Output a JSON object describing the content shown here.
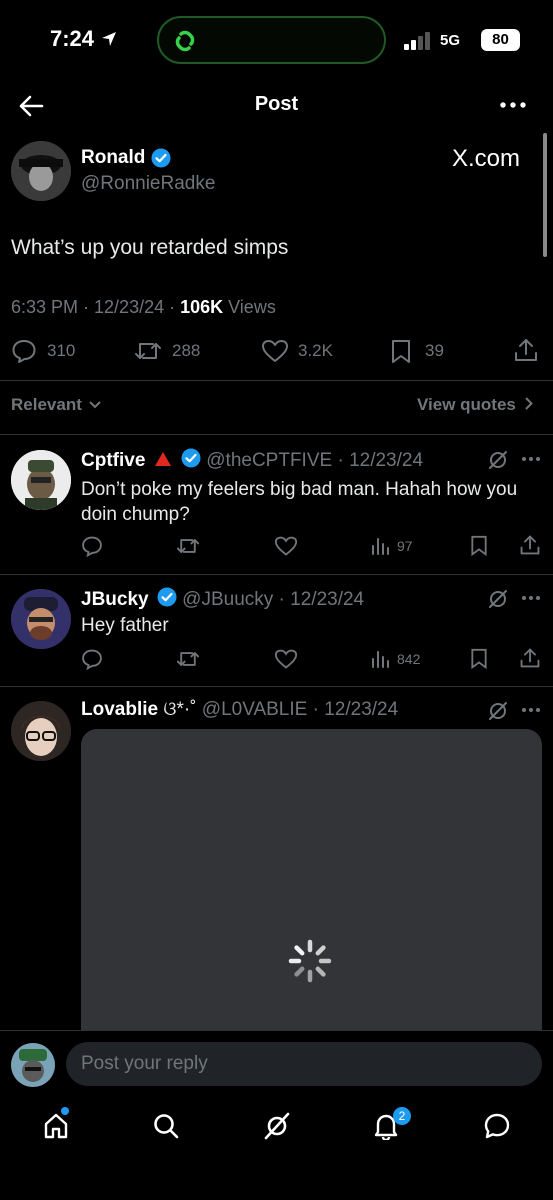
{
  "status_bar": {
    "time": "7:24",
    "network": "5G",
    "battery": "80"
  },
  "header": {
    "title": "Post"
  },
  "tweet": {
    "author_name": "Ronald",
    "author_handle": "@RonnieRadke",
    "source": "X.com",
    "text": "What’s up you retarded simps",
    "meta_time": "6:33 PM · 12/23/24 · ",
    "meta_views_count": "106K",
    "meta_views_label": " Views",
    "replies": "310",
    "reposts": "288",
    "likes": "3.2K",
    "bookmarks": "39"
  },
  "filter": {
    "sort_label": "Relevant",
    "view_quotes_label": "View quotes"
  },
  "replies": [
    {
      "name": "Cptfive",
      "handle_date": "@theCPTFIVE · 12/23/24",
      "text_line1": "Don’t poke my feelers big bad man. Hahah how you",
      "text_line2": "doin chump?",
      "views": "97"
    },
    {
      "name": "JBucky",
      "handle_date": "@JBuucky · 12/23/24",
      "text_line1": "Hey father",
      "views": "842"
    },
    {
      "name": "Lovablie",
      "name_suffix": "ଓ*·˚",
      "handle_date": "@L0VABLIE · 12/23/24"
    }
  ],
  "compose": {
    "placeholder": "Post your reply"
  },
  "nav": {
    "notifications_badge": "2"
  },
  "colors": {
    "accent": "#1d9bf0",
    "background": "#000000",
    "muted": "#71767b",
    "divider": "#2f3336"
  }
}
